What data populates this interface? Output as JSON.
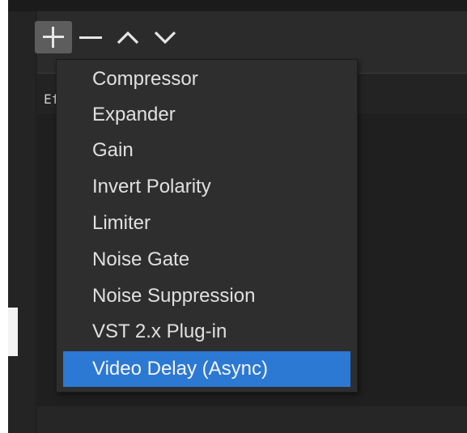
{
  "toolbar": {
    "add_icon": "plus-icon",
    "remove_icon": "minus-icon",
    "move_up_icon": "chevron-up-icon",
    "move_down_icon": "chevron-down-icon"
  },
  "filters_header": {
    "label": "Ef"
  },
  "menu": {
    "items": [
      {
        "label": "Compressor"
      },
      {
        "label": "Expander"
      },
      {
        "label": "Gain"
      },
      {
        "label": "Invert Polarity"
      },
      {
        "label": "Limiter"
      },
      {
        "label": "Noise Gate"
      },
      {
        "label": "Noise Suppression"
      },
      {
        "label": "VST 2.x Plug-in"
      },
      {
        "label": "Video Delay (Async)",
        "selected": true
      }
    ]
  },
  "colors": {
    "background": "#2b2b2b",
    "menu_background": "#2e2e2e",
    "selection": "#2c79d4",
    "text": "#e0e0e0"
  }
}
